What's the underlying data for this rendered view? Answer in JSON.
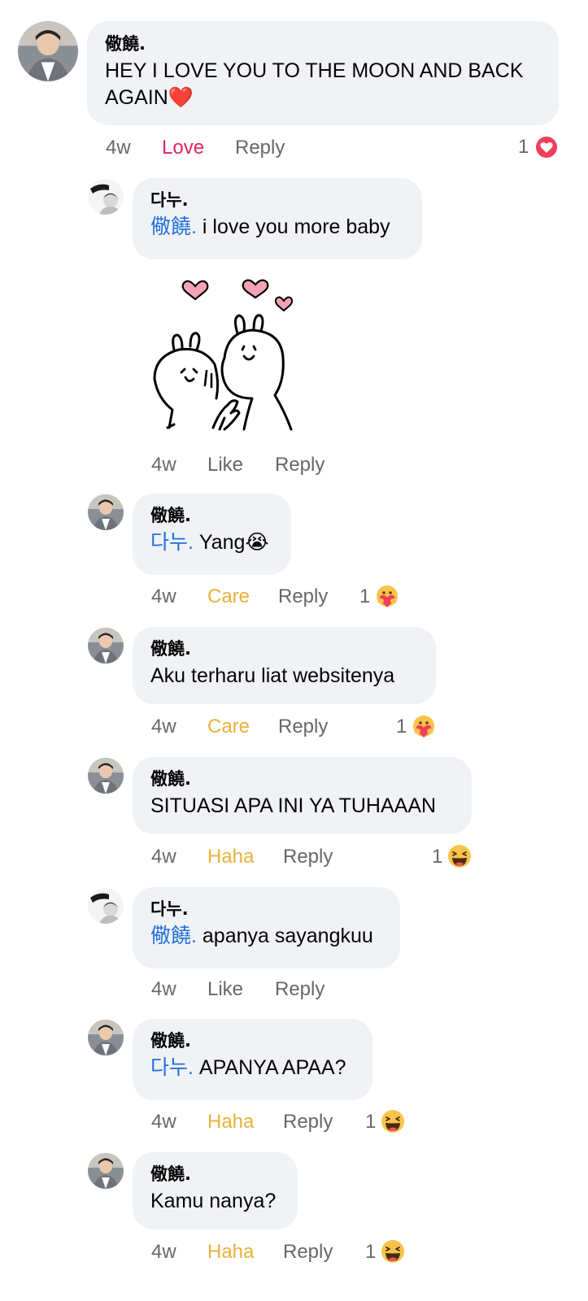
{
  "comments": [
    {
      "author": "儆饒.",
      "text": "HEY I LOVE YOU TO THE MOON AND BACK AGAIN",
      "emoji": "❤️",
      "time": "4w",
      "reaction_label": "Love",
      "reply_label": "Reply",
      "reaction_count": "1",
      "reaction_icon": "love-reaction-icon"
    },
    {
      "author": "다누.",
      "mention": "儆饒.",
      "text": "i love you more baby",
      "sticker": "two-bunnies-hearts-sticker",
      "time": "4w",
      "reaction_label": "Like",
      "reply_label": "Reply"
    },
    {
      "author": "儆饒.",
      "mention": "다누.",
      "text": "Yang",
      "emoji": "😭",
      "time": "4w",
      "reaction_label": "Care",
      "reply_label": "Reply",
      "reaction_count": "1",
      "reaction_icon": "care-reaction-icon"
    },
    {
      "author": "儆饒.",
      "text": "Aku terharu liat websitenya",
      "time": "4w",
      "reaction_label": "Care",
      "reply_label": "Reply",
      "reaction_count": "1",
      "reaction_icon": "care-reaction-icon"
    },
    {
      "author": "儆饒.",
      "text": "SITUASI APA INI YA TUHAAAN",
      "time": "4w",
      "reaction_label": "Haha",
      "reply_label": "Reply",
      "reaction_count": "1",
      "reaction_icon": "haha-reaction-icon"
    },
    {
      "author": "다누.",
      "mention": "儆饒.",
      "text": "apanya sayangkuu",
      "time": "4w",
      "reaction_label": "Like",
      "reply_label": "Reply"
    },
    {
      "author": "儆饒.",
      "mention": "다누.",
      "text": "APANYA APAA?",
      "time": "4w",
      "reaction_label": "Haha",
      "reply_label": "Reply",
      "reaction_count": "1",
      "reaction_icon": "haha-reaction-icon"
    },
    {
      "author": "儆饒.",
      "text": "Kamu nanya?",
      "time": "4w",
      "reaction_label": "Haha",
      "reply_label": "Reply",
      "reaction_count": "1",
      "reaction_icon": "haha-reaction-icon"
    }
  ],
  "colors": {
    "bubble": "#f0f2f5",
    "mention": "#216fdb",
    "meta": "#65676b",
    "love": "#e0245e",
    "care_haha": "#e9b13a"
  }
}
